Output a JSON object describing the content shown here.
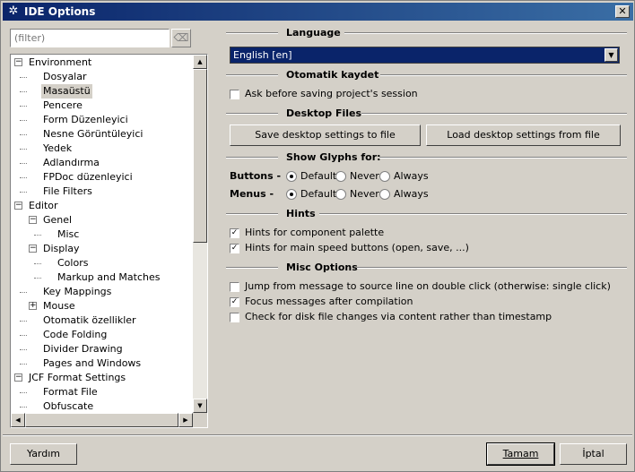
{
  "window": {
    "title": "IDE Options",
    "close_glyph": "✕"
  },
  "filter": {
    "placeholder": "(filter)"
  },
  "tree": [
    {
      "label": "Environment",
      "expander": "−"
    },
    {
      "label": "Dosyalar"
    },
    {
      "label": "Masaüstü",
      "selected": true
    },
    {
      "label": "Pencere"
    },
    {
      "label": "Form Düzenleyici"
    },
    {
      "label": "Nesne Görüntüleyici"
    },
    {
      "label": "Yedek"
    },
    {
      "label": "Adlandırma"
    },
    {
      "label": "FPDoc düzenleyici"
    },
    {
      "label": "File Filters"
    },
    {
      "label": "Editor",
      "expander": "−"
    },
    {
      "label": "Genel",
      "expander": "−"
    },
    {
      "label": "Misc"
    },
    {
      "label": "Display",
      "expander": "−"
    },
    {
      "label": "Colors"
    },
    {
      "label": "Markup and Matches"
    },
    {
      "label": "Key Mappings"
    },
    {
      "label": "Mouse",
      "expander": "+"
    },
    {
      "label": "Otomatik özellikler"
    },
    {
      "label": "Code Folding"
    },
    {
      "label": "Divider Drawing"
    },
    {
      "label": "Pages and Windows"
    },
    {
      "label": "JCF Format Settings",
      "expander": "−"
    },
    {
      "label": "Format File"
    },
    {
      "label": "Obfuscate"
    }
  ],
  "language": {
    "title": "Language",
    "selected": "English [en]"
  },
  "autosave": {
    "title": "Otomatik kaydet",
    "ask_label": "Ask before saving project's session",
    "ask_checked": false
  },
  "desktop_files": {
    "title": "Desktop Files",
    "save_label": "Save desktop settings to file",
    "load_label": "Load desktop settings from file"
  },
  "glyphs": {
    "title": "Show Glyphs for:",
    "buttons_label": "Buttons -",
    "menus_label": "Menus -",
    "opt_default": "Default",
    "opt_never": "Never",
    "opt_always": "Always",
    "buttons_value": "Default",
    "menus_value": "Default"
  },
  "hints": {
    "title": "Hints",
    "palette_label": "Hints for component palette",
    "palette_checked": true,
    "speed_label": "Hints for main speed buttons (open, save, ...)",
    "speed_checked": true
  },
  "misc": {
    "title": "Misc Options",
    "jump_label": "Jump from message to source line on double click (otherwise: single click)",
    "jump_checked": false,
    "focus_label": "Focus messages after compilation",
    "focus_checked": true,
    "disk_label": "Check for disk file changes via content rather than timestamp",
    "disk_checked": false
  },
  "footer": {
    "help_label": "Yardım",
    "ok_label": "Tamam",
    "cancel_label": "İptal"
  }
}
